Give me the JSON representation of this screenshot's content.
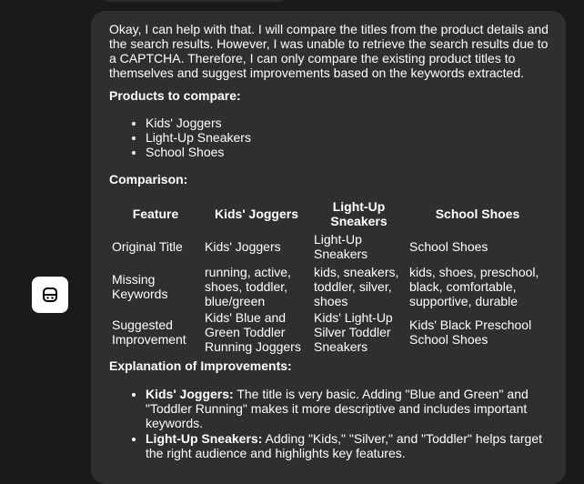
{
  "message": {
    "intro": "Okay, I can help with that. I will compare the titles from the product details and the search results. However, I was unable to retrieve the search results due to a CAPTCHA. Therefore, I can only compare the existing product titles to themselves and suggest improvements based on the keywords extracted.",
    "products_heading": "Products to compare:",
    "products": [
      "Kids' Joggers",
      "Light-Up Sneakers",
      "School Shoes"
    ],
    "comparison_heading": "Comparison:",
    "table": {
      "headers": [
        "Feature",
        "Kids' Joggers",
        "Light-Up Sneakers",
        "School Shoes"
      ],
      "rows": [
        [
          "Original Title",
          "Kids' Joggers",
          "Light-Up Sneakers",
          "School Shoes"
        ],
        [
          "Missing Keywords",
          "running, active, shoes, toddler, blue/green",
          "kids, sneakers, toddler, silver, shoes",
          "kids, shoes, preschool, black, comfortable, supportive, durable"
        ],
        [
          "Suggested Improvement",
          "Kids' Blue and Green Toddler Running Joggers",
          "Kids' Light-Up Silver Toddler Sneakers",
          "Kids' Black Preschool School Shoes"
        ]
      ]
    },
    "explanation_heading": "Explanation of Improvements:",
    "explanations": [
      {
        "name": "Kids' Joggers:",
        "text": " The title is very basic. Adding \"Blue and Green\" and \"Toddler Running\" makes it more descriptive and includes important keywords."
      },
      {
        "name": "Light-Up Sneakers:",
        "text": " Adding \"Kids,\" \"Silver,\" and \"Toddler\" helps target the right audience and highlights key features."
      }
    ]
  },
  "avatar": {
    "icon": "robot-icon"
  },
  "colors": {
    "background": "#1a1a1a",
    "bubble": "#2f2f2f",
    "text": "#ffffff",
    "avatar_bg": "#ffffff"
  }
}
